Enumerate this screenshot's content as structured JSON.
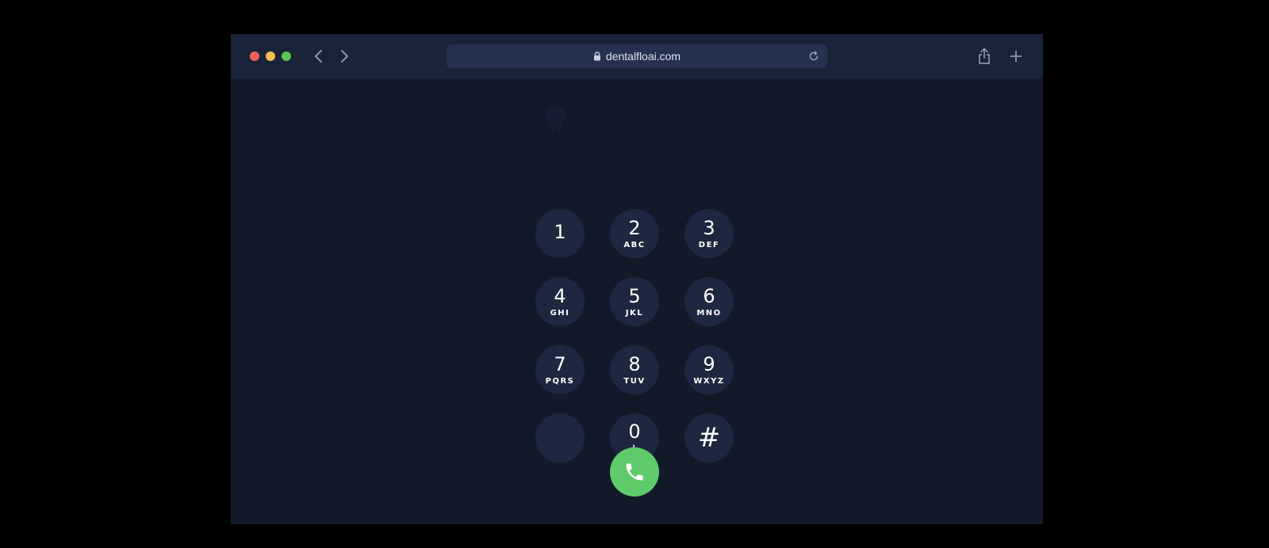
{
  "browser": {
    "url": "dentalfloai.com"
  },
  "keypad": [
    {
      "digit": "1",
      "letters": ""
    },
    {
      "digit": "2",
      "letters": "ABC"
    },
    {
      "digit": "3",
      "letters": "DEF"
    },
    {
      "digit": "4",
      "letters": "GHI"
    },
    {
      "digit": "5",
      "letters": "JKL"
    },
    {
      "digit": "6",
      "letters": "MNO"
    },
    {
      "digit": "7",
      "letters": "PQRS"
    },
    {
      "digit": "8",
      "letters": "TUV"
    },
    {
      "digit": "9",
      "letters": "WXYZ"
    },
    {
      "digit": "",
      "letters": ""
    },
    {
      "digit": "0",
      "letters": "+"
    },
    {
      "digit": "#",
      "letters": ""
    }
  ],
  "icons": {
    "call": "phone-icon",
    "lock": "lock-icon",
    "reload": "reload-icon",
    "share": "share-icon",
    "newtab": "plus-icon",
    "back": "chevron-left-icon",
    "forward": "chevron-right-icon"
  },
  "colors": {
    "background": "#121a29",
    "toolbar": "#1a2438",
    "key": "#1d2840",
    "call": "#5fca6a"
  }
}
